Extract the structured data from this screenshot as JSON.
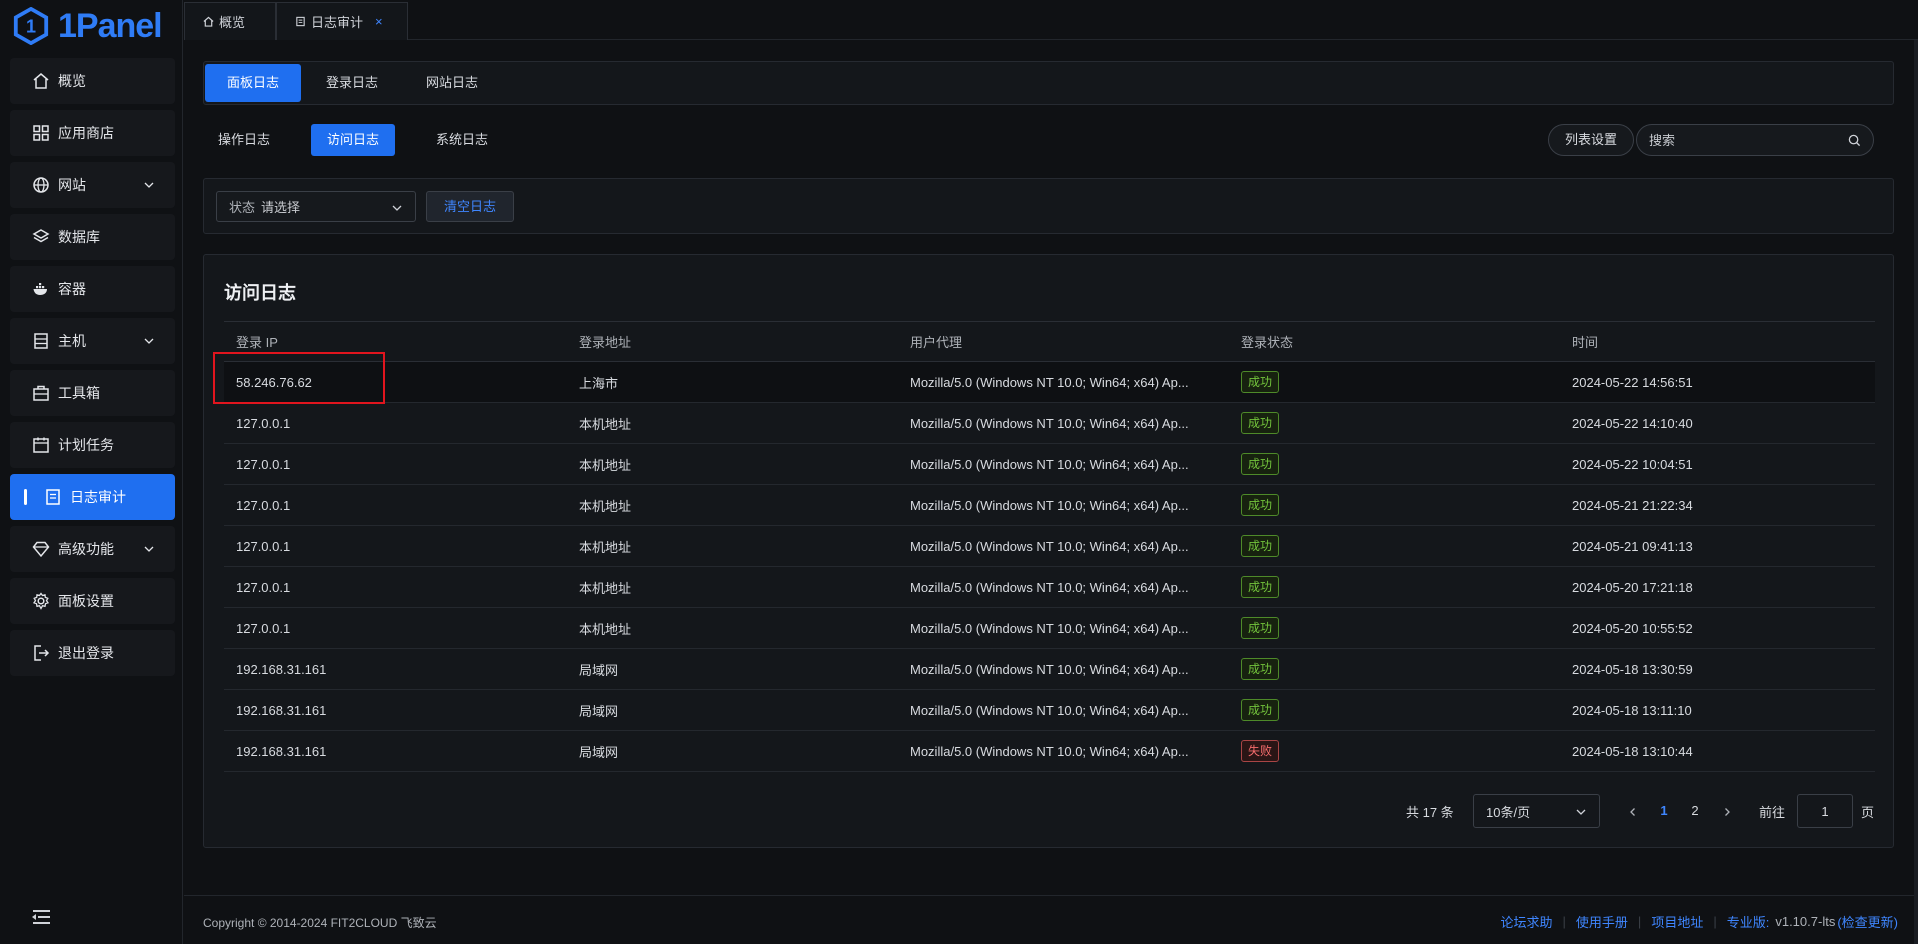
{
  "brand": {
    "name": "1Panel"
  },
  "sidebar": {
    "items": [
      {
        "label": "概览",
        "icon": "home-icon"
      },
      {
        "label": "应用商店",
        "icon": "grid-icon"
      },
      {
        "label": "网站",
        "icon": "globe-icon",
        "expandable": true
      },
      {
        "label": "数据库",
        "icon": "layers-icon"
      },
      {
        "label": "容器",
        "icon": "docker-icon"
      },
      {
        "label": "主机",
        "icon": "server-icon",
        "expandable": true
      },
      {
        "label": "工具箱",
        "icon": "toolbox-icon"
      },
      {
        "label": "计划任务",
        "icon": "calendar-icon"
      },
      {
        "label": "日志审计",
        "icon": "log-icon",
        "active": true
      },
      {
        "label": "高级功能",
        "icon": "diamond-icon",
        "expandable": true
      },
      {
        "label": "面板设置",
        "icon": "gear-icon"
      },
      {
        "label": "退出登录",
        "icon": "logout-icon"
      }
    ]
  },
  "topbar": {
    "tabs": [
      {
        "label": "概览"
      },
      {
        "label": "日志审计",
        "close": "×"
      }
    ]
  },
  "subtabs": [
    "面板日志",
    "登录日志",
    "网站日志"
  ],
  "segments": [
    "操作日志",
    "访问日志",
    "系统日志"
  ],
  "toolbar": {
    "columns_label": "列表设置",
    "search_placeholder": "搜索"
  },
  "filter": {
    "status_label": "状态",
    "status_placeholder": "请选择",
    "clear_label": "清空日志"
  },
  "table": {
    "title": "访问日志",
    "headers": [
      "登录 IP",
      "登录地址",
      "用户代理",
      "登录状态",
      "时间"
    ],
    "rows": [
      {
        "ip": "58.246.76.62",
        "addr": "上海市",
        "ua": "Mozilla/5.0 (Windows NT 10.0; Win64; x64) Ap...",
        "status": "成功",
        "ok": true,
        "time": "2024-05-22 14:56:51"
      },
      {
        "ip": "127.0.0.1",
        "addr": "本机地址",
        "ua": "Mozilla/5.0 (Windows NT 10.0; Win64; x64) Ap...",
        "status": "成功",
        "ok": true,
        "time": "2024-05-22 14:10:40"
      },
      {
        "ip": "127.0.0.1",
        "addr": "本机地址",
        "ua": "Mozilla/5.0 (Windows NT 10.0; Win64; x64) Ap...",
        "status": "成功",
        "ok": true,
        "time": "2024-05-22 10:04:51"
      },
      {
        "ip": "127.0.0.1",
        "addr": "本机地址",
        "ua": "Mozilla/5.0 (Windows NT 10.0; Win64; x64) Ap...",
        "status": "成功",
        "ok": true,
        "time": "2024-05-21 21:22:34"
      },
      {
        "ip": "127.0.0.1",
        "addr": "本机地址",
        "ua": "Mozilla/5.0 (Windows NT 10.0; Win64; x64) Ap...",
        "status": "成功",
        "ok": true,
        "time": "2024-05-21 09:41:13"
      },
      {
        "ip": "127.0.0.1",
        "addr": "本机地址",
        "ua": "Mozilla/5.0 (Windows NT 10.0; Win64; x64) Ap...",
        "status": "成功",
        "ok": true,
        "time": "2024-05-20 17:21:18"
      },
      {
        "ip": "127.0.0.1",
        "addr": "本机地址",
        "ua": "Mozilla/5.0 (Windows NT 10.0; Win64; x64) Ap...",
        "status": "成功",
        "ok": true,
        "time": "2024-05-20 10:55:52"
      },
      {
        "ip": "192.168.31.161",
        "addr": "局域网",
        "ua": "Mozilla/5.0 (Windows NT 10.0; Win64; x64) Ap...",
        "status": "成功",
        "ok": true,
        "time": "2024-05-18 13:30:59"
      },
      {
        "ip": "192.168.31.161",
        "addr": "局域网",
        "ua": "Mozilla/5.0 (Windows NT 10.0; Win64; x64) Ap...",
        "status": "成功",
        "ok": true,
        "time": "2024-05-18 13:11:10"
      },
      {
        "ip": "192.168.31.161",
        "addr": "局域网",
        "ua": "Mozilla/5.0 (Windows NT 10.0; Win64; x64) Ap...",
        "status": "失败",
        "ok": false,
        "time": "2024-05-18 13:10:44"
      }
    ]
  },
  "pagination": {
    "total_text": "共 17 条",
    "page_size": "10条/页",
    "pages": [
      "1",
      "2"
    ],
    "current": "1",
    "goto_label": "前往",
    "goto_value": "1",
    "page_suffix": "页"
  },
  "footer": {
    "copyright": "Copyright © 2014-2024 FIT2CLOUD 飞致云",
    "links": [
      "论坛求助",
      "使用手册",
      "项目地址"
    ],
    "edition_label": "专业版:",
    "version": "v1.10.7-lts",
    "update_link": "(检查更新)"
  },
  "colors": {
    "accent": "#1f6ff0",
    "link": "#3f86ff",
    "success": "#73c43c",
    "danger": "#f56c6c",
    "highlight": "#e1151e"
  }
}
